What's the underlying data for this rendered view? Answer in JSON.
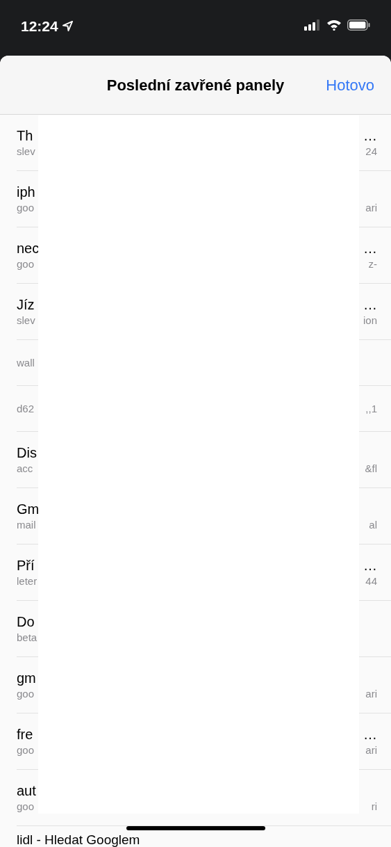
{
  "status_bar": {
    "time": "12:24"
  },
  "sheet": {
    "title": "Poslední zavřené panely",
    "done_button": "Hotovo"
  },
  "closed_tabs": [
    {
      "title_start": "Th",
      "title_end": "…",
      "url_start": "slev",
      "url_end": "24"
    },
    {
      "title_start": "iph",
      "url_start": "goo",
      "url_end": "ari"
    },
    {
      "title_start": "nec",
      "title_end": "…",
      "url_start": "goo",
      "url_end": "z-"
    },
    {
      "title_start": "Jíz",
      "title_end": "…",
      "url_start": "slev",
      "url_end": "ion"
    },
    {
      "url_start": "wall"
    },
    {
      "url_start": "d62",
      "url_end": ",,1"
    },
    {
      "title_start": "Dis",
      "url_start": "acc",
      "url_end": "&fl"
    },
    {
      "title_start": "Gm",
      "url_start": "mail",
      "url_end": "al"
    },
    {
      "title_start": "Pří",
      "title_end": "…",
      "url_start": "leter",
      "url_end": "44"
    },
    {
      "title_start": "Do",
      "url_start": "beta"
    },
    {
      "title_start": "gm",
      "url_start": "goo",
      "url_end": "ari"
    },
    {
      "title_start": "fre",
      "title_end": "…",
      "url_start": "goo",
      "url_end": "ari"
    },
    {
      "title_start": "aut",
      "url_start": "goo",
      "url_end": "ri"
    }
  ],
  "last_tab": {
    "title": "lidl - Hledat Googlem"
  }
}
